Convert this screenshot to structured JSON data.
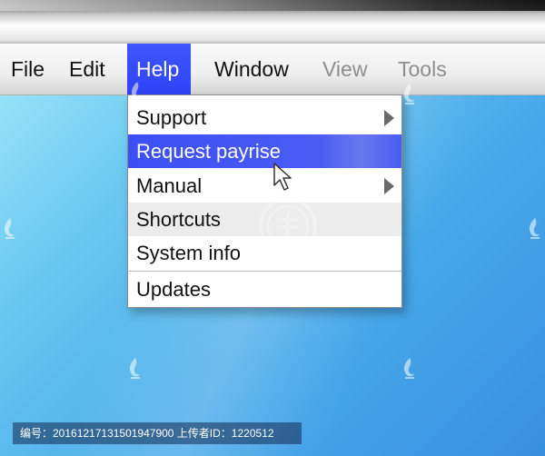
{
  "menubar": {
    "items": [
      {
        "label": "File",
        "state": "normal"
      },
      {
        "label": "Edit",
        "state": "normal"
      },
      {
        "label": "Help",
        "state": "active"
      },
      {
        "label": "Window",
        "state": "normal"
      },
      {
        "label": "View",
        "state": "disabled"
      },
      {
        "label": "Tools",
        "state": "disabled"
      }
    ]
  },
  "help_menu": {
    "items": [
      {
        "label": "Support",
        "has_submenu": true
      },
      {
        "label": "Request payrise",
        "highlighted": true
      },
      {
        "label": "Manual",
        "has_submenu": true
      },
      {
        "label": "Shortcuts"
      },
      {
        "label": "System info"
      },
      {
        "label": "Updates"
      }
    ]
  },
  "footer": {
    "text": "编号：20161217131501947900 上传者ID：1220512"
  },
  "icons": [
    "submenu-arrow-icon",
    "mouse-pointer-icon",
    "watermark-logo-icon"
  ],
  "colors": {
    "accent": "#3f55ff",
    "desktop_top": "#a8eefc",
    "desktop_bottom": "#3a8fe0",
    "menubar": "#eeeeee",
    "disabled_text": "#8d8d8d"
  }
}
